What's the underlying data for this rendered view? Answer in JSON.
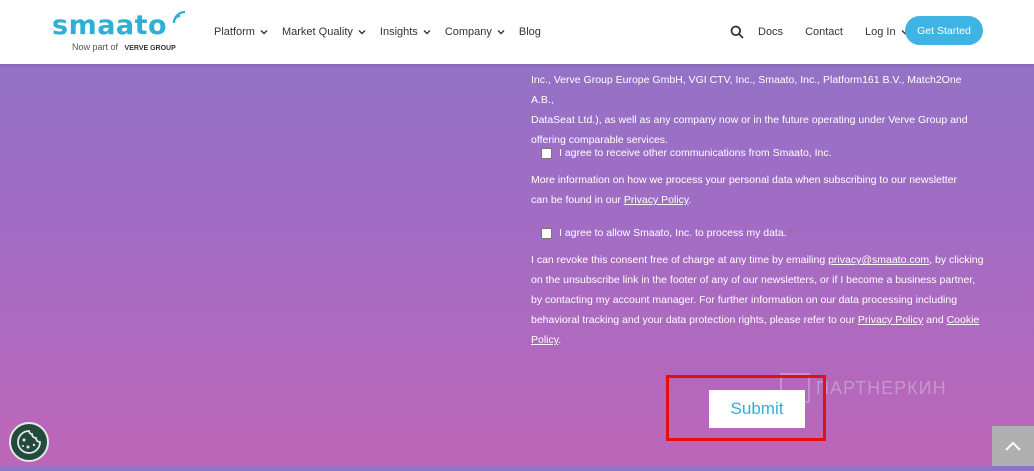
{
  "header": {
    "logo_text": "smaato",
    "logo_sub": "Now part of",
    "logo_partner": "VERVE GROUP",
    "nav": [
      {
        "label": "Platform",
        "has_dropdown": true
      },
      {
        "label": "Market Quality",
        "has_dropdown": true
      },
      {
        "label": "Insights",
        "has_dropdown": true
      },
      {
        "label": "Company",
        "has_dropdown": true
      },
      {
        "label": "Blog",
        "has_dropdown": false
      }
    ],
    "docs": "Docs",
    "contact": "Contact",
    "login": "Log In",
    "cta": "Get Started"
  },
  "form": {
    "para1_lines": [
      "Inc., Verve Group Europe GmbH, VGI CTV, Inc., Smaato, Inc., Platform161 B.V., Match2One A.B.,",
      "DataSeat Ltd.), as well as any company now or in the future operating under Verve Group and",
      "offering comparable services."
    ],
    "checkbox1_label": "I agree to receive other communications from Smaato, Inc.",
    "para2_line1": "More information on how we process your personal data when subscribing to our newsletter",
    "para2_line2_prefix": "can be found in our ",
    "privacy_policy": "Privacy Policy",
    "para2_line2_suffix": ".",
    "checkbox2_label": "I agree to allow Smaato, Inc. to process my data.",
    "required_mark": "*",
    "para3_l1_prefix": "I can revoke this consent free of charge at any time by emailing ",
    "email": "privacy@smaato.com",
    "para3_l1_suffix": ", by clicking",
    "para3_l2": "on the unsubscribe link in the footer of any of our newsletters, or if I become a business partner,",
    "para3_l3": "by contacting my account manager. For further information on our data processing including",
    "para3_l4_prefix": "behavioral tracking and your data protection rights, please refer to our ",
    "privacy_policy_2": "Privacy Policy",
    "para3_l4_and": " and ",
    "cookie_word": "Cookie",
    "policy_word": "Policy",
    "para3_l5_suffix": ".",
    "submit_label": "Submit"
  },
  "watermark_text": "ПАРТНЕРКИН",
  "colors": {
    "accent": "#2dafd6",
    "cta_bg": "#3fb4e4",
    "highlight": "#e31010",
    "cookie_bg": "#234b3d"
  },
  "icons": [
    "search-icon",
    "chevron-down-icon",
    "cookie-icon",
    "chevron-up-icon",
    "signal-icon"
  ]
}
